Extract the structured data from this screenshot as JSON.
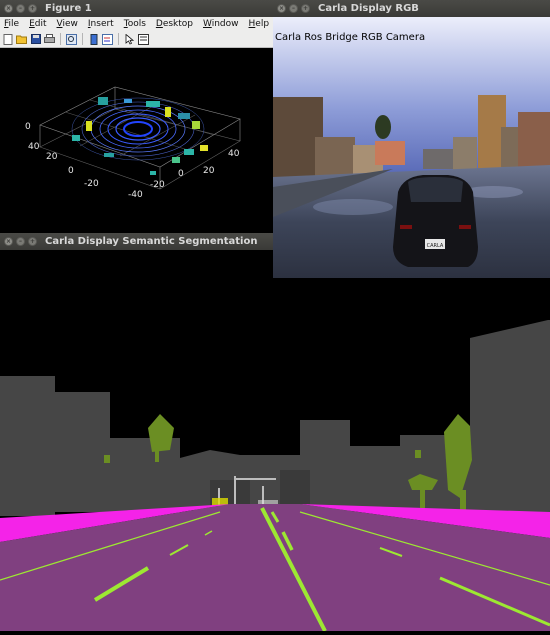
{
  "figure": {
    "title": "Figure 1",
    "menu": [
      "File",
      "Edit",
      "View",
      "Insert",
      "Tools",
      "Desktop",
      "Window",
      "Help"
    ],
    "toolbar_icons": [
      "new-file-icon",
      "open-folder-icon",
      "save-icon",
      "print-icon",
      "zoom-icon",
      "colorbar-icon",
      "legend-icon",
      "pointer-icon",
      "data-cursor-icon"
    ],
    "axes": {
      "z_tick": "0",
      "y_ticks": [
        "40",
        "20",
        "0",
        "-20"
      ],
      "x_ticks": [
        "40",
        "20",
        "0",
        "-20",
        "-40"
      ]
    }
  },
  "rgb": {
    "title": "Carla Display RGB",
    "caption": "Carla Ros Bridge RGB Camera",
    "plate_text": "CARLA"
  },
  "segmentation": {
    "title": "Carla Display Semantic Segmentation"
  },
  "colors": {
    "road": "#804080",
    "sidewalk": "#f423e8",
    "building": "#464646",
    "vegetation": "#6b8e23",
    "lane_marking": "#9de832",
    "lidar_point": "#3a5bff"
  }
}
